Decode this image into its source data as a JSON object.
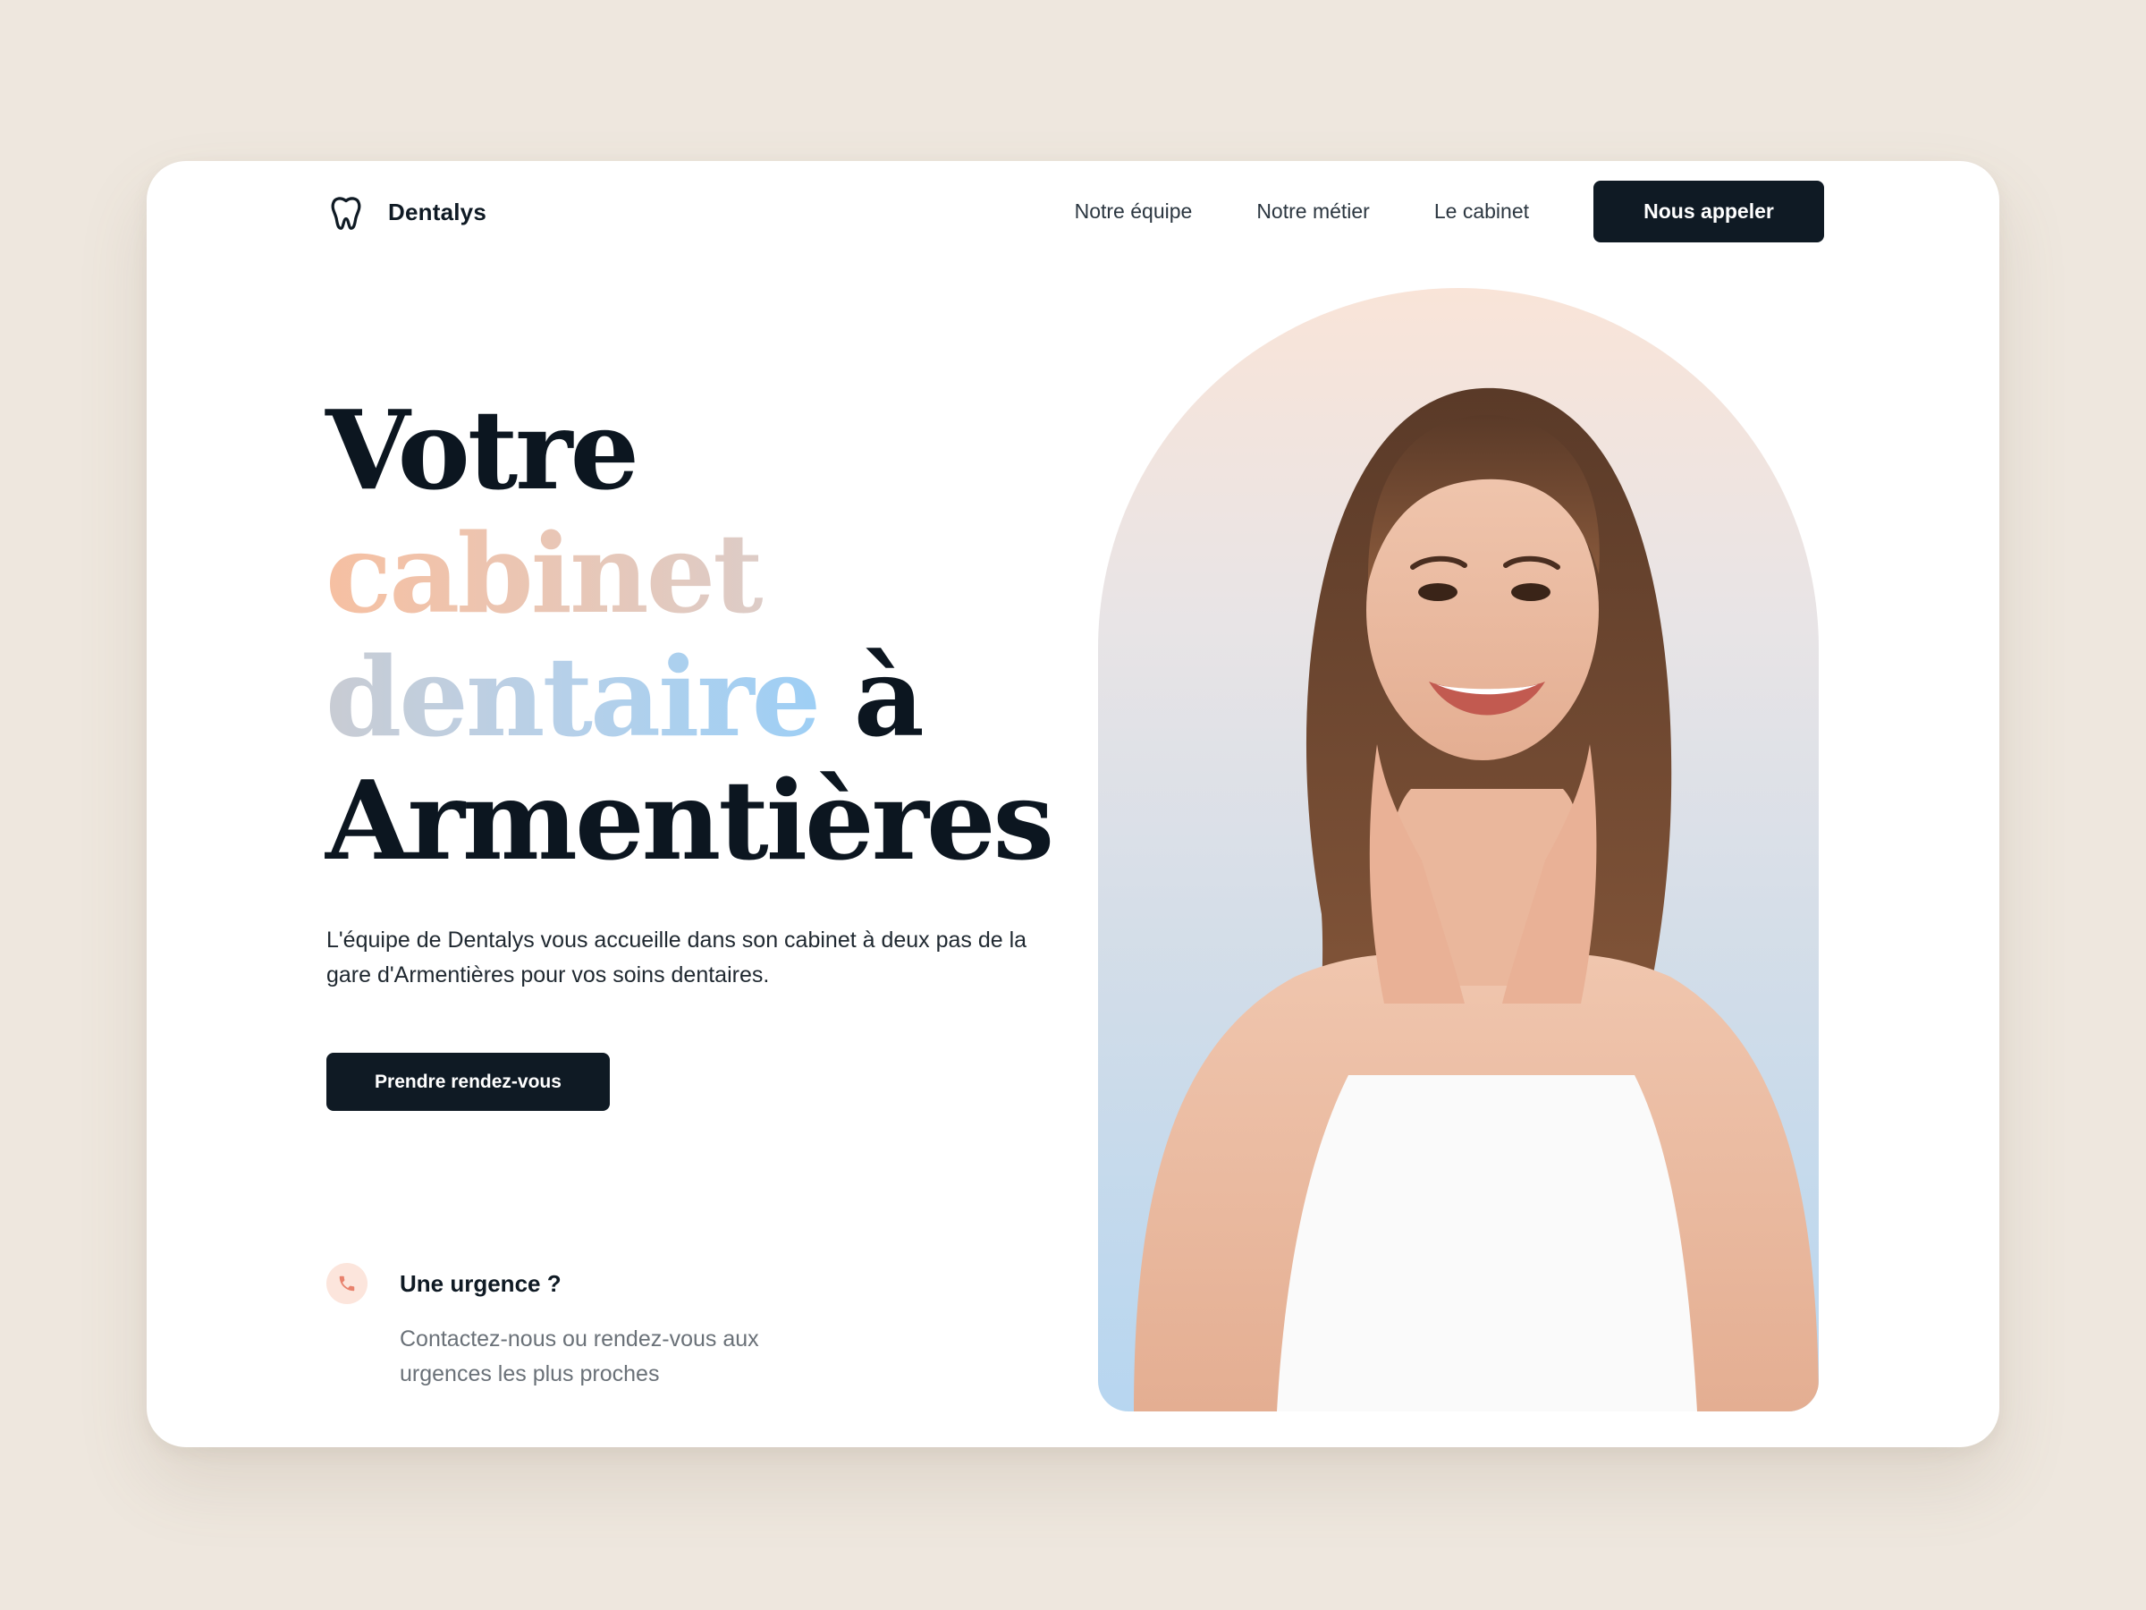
{
  "brand": {
    "name": "Dentalys",
    "logo_icon": "tooth-icon"
  },
  "nav": {
    "links": [
      "Notre équipe",
      "Notre métier",
      "Le cabinet"
    ],
    "cta": "Nous appeler"
  },
  "hero": {
    "headline": {
      "line1": "Votre",
      "line2": "cabinet",
      "line3a": "dentaire",
      "line3b": " à",
      "line4": "Armentières"
    },
    "description": "L'équipe de Dentalys vous accueille dans son cabinet à deux pas de la gare d'Armentières pour vos soins dentaires.",
    "cta": "Prendre rendez-vous",
    "image": "woman-smiling-photo"
  },
  "urgent": {
    "icon": "phone-icon",
    "title": "Une urgence ?",
    "text": "Contactez-nous ou rendez-vous aux urgences les plus proches"
  },
  "colors": {
    "page_bg": "#EEE7DE",
    "card_bg": "#FFFFFF",
    "primary": "#0F1A24",
    "accent_peach": "#F6C0A2",
    "accent_blue": "#9ECFF5",
    "urgent_bg": "#FCE5DC",
    "urgent_icon": "#E8826D"
  }
}
